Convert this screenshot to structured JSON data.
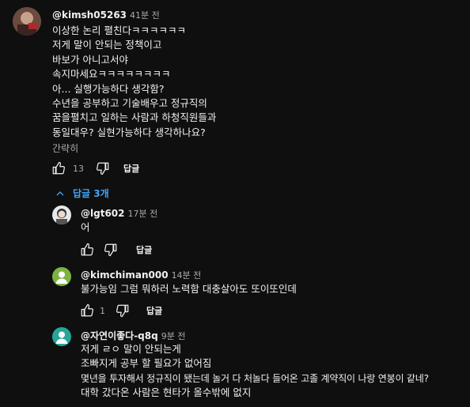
{
  "comment": {
    "handle": "@kimsh05263",
    "time": "41분 전",
    "lines": [
      "이상한 논리 펼친다ㅋㅋㅋㅋㅋㅋ",
      "저게 말이 안되는 정책이고",
      "바보가 아니고서야",
      "속지마세요ㅋㅋㅋㅋㅋㅋㅋㅋ",
      "아... 실행가능하다 생각함?",
      "수년을 공부하고 기술배우고 정규직의",
      "꿈을펼치고 일하는 사람과 하청직원들과",
      "동일대우? 실현가능하다 생각하나요?"
    ],
    "collapse_label": "간략히",
    "likes": "13",
    "reply_label": "답글"
  },
  "replies_toggle": {
    "label": "답글 3개"
  },
  "replies": [
    {
      "handle": "@lgt602",
      "time": "17분 전",
      "lines": [
        "어"
      ],
      "likes": "",
      "reply_label": "답글"
    },
    {
      "handle": "@kimchiman000",
      "time": "14분 전",
      "lines": [
        "불가능임 그럼 뭐하러 노력함 대충살아도 또이또인데"
      ],
      "likes": "1",
      "reply_label": "답글"
    },
    {
      "handle": "@자연이좋다-q8q",
      "time": "9분 전",
      "lines": [
        "저게 ㄹㅇ 말이 안되는게",
        "조빠지게 공부 할 필요가 없어짐",
        "몇년을 투자해서 정규직이 됐는데 놀거 다 처놀다 들어온 고졸 계약직이 나랑 연봉이 같네?",
        "대학 갔다온 사람은 현타가 올수밖에 없지"
      ],
      "likes": "",
      "reply_label": "답글"
    }
  ],
  "colors": {
    "link": "#3ea6ff",
    "background": "#0f0f0f",
    "text": "#f1f1f1",
    "muted": "#aaaaaa"
  },
  "icons": [
    "like-icon",
    "dislike-icon",
    "chevron-up-icon"
  ]
}
